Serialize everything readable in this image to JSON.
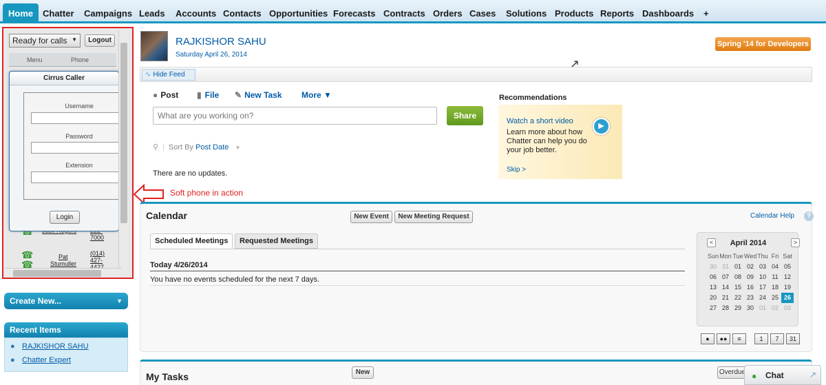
{
  "nav": {
    "tabs": [
      "Home",
      "Chatter",
      "Campaigns",
      "Leads",
      "Accounts",
      "Contacts",
      "Opportunities",
      "Forecasts",
      "Contracts",
      "Orders",
      "Cases",
      "Solutions",
      "Products",
      "Reports",
      "Dashboards"
    ],
    "add_tab": "+",
    "active": "Home"
  },
  "softphone": {
    "status": "Ready for calls",
    "status_caret": "▼",
    "logout": "Logout",
    "col_menu": "Menu",
    "col_phone": "Phone",
    "caller": {
      "title": "Cirrus Caller",
      "username_label": "Username",
      "password_label": "Password",
      "extension_label": "Extension",
      "login": "Login"
    },
    "contacts": [
      {
        "name": "Jack Rogers",
        "phone_lines": [
          "222-",
          "7000"
        ]
      },
      {
        "name_lines": [
          "Pat",
          "Stumuller"
        ],
        "phone_lines": [
          "(014)",
          "427-",
          "4427"
        ]
      }
    ]
  },
  "create_new": {
    "label": "Create New...",
    "caret": "▼"
  },
  "recent": {
    "title": "Recent Items",
    "items": [
      "RAJKISHOR SAHU",
      "Chatter Expert"
    ]
  },
  "profile": {
    "name": "RAJKISHOR SAHU",
    "date": "Saturday April 26, 2014"
  },
  "badge": "Spring '14 for Developers",
  "feed": {
    "hide_feed": "Hide Feed",
    "publisher_tabs": [
      "Post",
      "File",
      "New Task",
      "More ▼"
    ],
    "placeholder": "What are you working on?",
    "share": "Share",
    "sort_by": "Sort By",
    "sort_value": "Post Date",
    "empty": "There are no updates."
  },
  "recommendations": {
    "title": "Recommendations",
    "video": "Watch a short video",
    "text": "Learn more about how Chatter can help you do your job better.",
    "skip": "Skip >"
  },
  "annotation": {
    "text": "Soft phone in action",
    "color": "#e02020"
  },
  "calendar": {
    "title": "Calendar",
    "new_event": "New Event",
    "new_meeting": "New Meeting Request",
    "help": "Calendar Help",
    "tabs": [
      "Scheduled Meetings",
      "Requested Meetings"
    ],
    "today": "Today 4/26/2014",
    "no_events": "You have no events scheduled for the next 7 days.",
    "mini": {
      "month": "April 2014",
      "prev": "<",
      "next": ">",
      "days": [
        "Sun",
        "Mon",
        "Tue",
        "Wed",
        "Thu",
        "Fri",
        "Sat"
      ],
      "weeks": [
        [
          "30",
          "31",
          "01",
          "02",
          "03",
          "04",
          "05"
        ],
        [
          "06",
          "07",
          "08",
          "09",
          "10",
          "11",
          "12"
        ],
        [
          "13",
          "14",
          "15",
          "16",
          "17",
          "18",
          "19"
        ],
        [
          "20",
          "21",
          "22",
          "23",
          "24",
          "25",
          "26"
        ],
        [
          "27",
          "28",
          "29",
          "30",
          "01",
          "02",
          "03"
        ]
      ],
      "today": "26",
      "view_buttons": [
        "1",
        "7",
        "31"
      ]
    }
  },
  "tasks": {
    "title": "My Tasks",
    "new": "New",
    "filter": "Overdue"
  },
  "chat": {
    "label": "Chat"
  },
  "colors": {
    "accent": "#1797c0",
    "link": "#015ba7",
    "share": "#6aa62a",
    "badge": "#e8892a"
  }
}
